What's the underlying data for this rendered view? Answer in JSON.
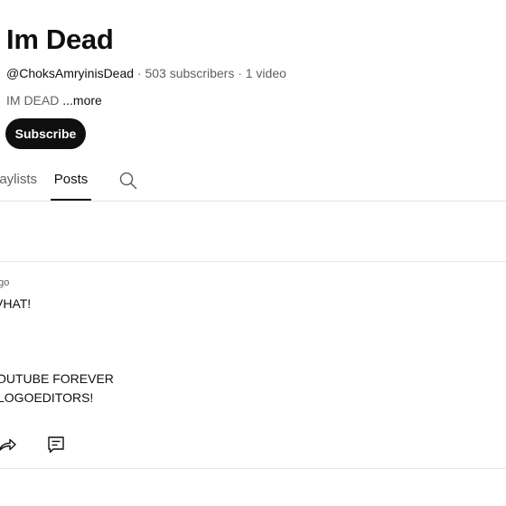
{
  "channel": {
    "name": "Im Dead",
    "handle": "@ChoksAmryinisDead",
    "subscribers": " · 503 subscribers · 1 video",
    "description": "IM DEAD ",
    "more_label": "...more",
    "subscribe_label": "Subscribe"
  },
  "tabs": [
    {
      "label": "Playlists"
    },
    {
      "label": "Posts",
      "selected": true
    }
  ],
  "tab_search_icon": "search-icon",
  "post": {
    "time": "ago",
    "lines": [
      "VHAT!",
      "OUTUBE FOREVER",
      "LOGOEDITORS!"
    ],
    "action_icons": [
      "share-icon",
      "comment-icon"
    ]
  }
}
